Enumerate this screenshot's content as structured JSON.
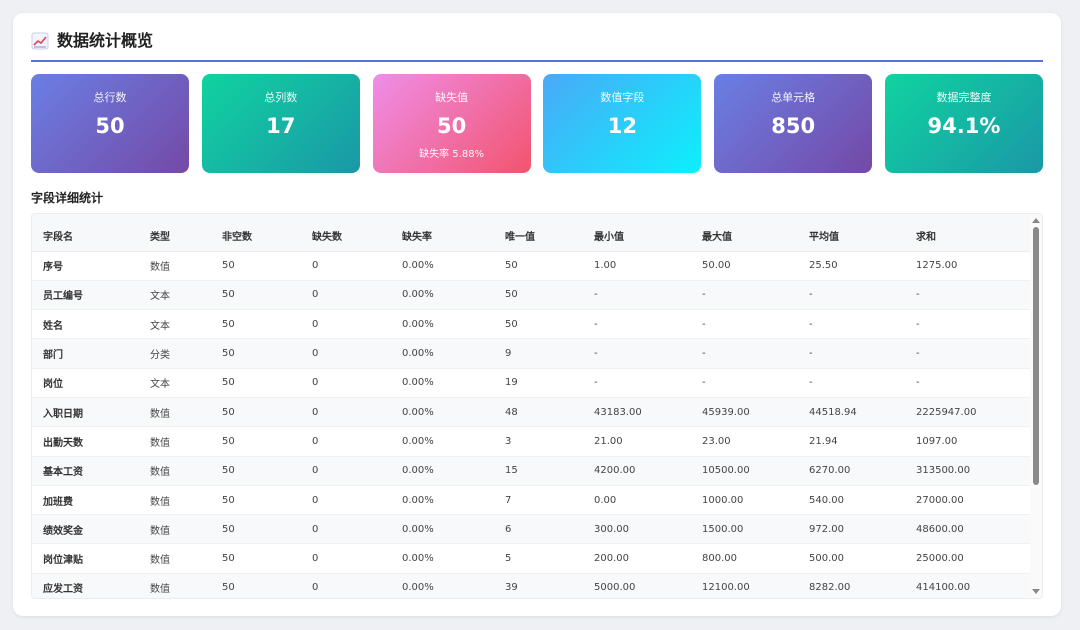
{
  "header": {
    "title": "数据统计概览",
    "icon": "chart-increasing-icon"
  },
  "cards": [
    {
      "label": "总行数",
      "value": "50"
    },
    {
      "label": "总列数",
      "value": "17"
    },
    {
      "label": "缺失值",
      "value": "50",
      "sub": "缺失率 5.88%"
    },
    {
      "label": "数值字段",
      "value": "12"
    },
    {
      "label": "总单元格",
      "value": "850"
    },
    {
      "label": "数据完整度",
      "value": "94.1%"
    }
  ],
  "section_title": "字段详细统计",
  "table": {
    "headers": [
      "字段名",
      "类型",
      "非空数",
      "缺失数",
      "缺失率",
      "唯一值",
      "最小值",
      "最大值",
      "平均值",
      "求和"
    ],
    "rows": [
      [
        "序号",
        "数值",
        "50",
        "0",
        "0.00%",
        "50",
        "1.00",
        "50.00",
        "25.50",
        "1275.00"
      ],
      [
        "员工编号",
        "文本",
        "50",
        "0",
        "0.00%",
        "50",
        "-",
        "-",
        "-",
        "-"
      ],
      [
        "姓名",
        "文本",
        "50",
        "0",
        "0.00%",
        "50",
        "-",
        "-",
        "-",
        "-"
      ],
      [
        "部门",
        "分类",
        "50",
        "0",
        "0.00%",
        "9",
        "-",
        "-",
        "-",
        "-"
      ],
      [
        "岗位",
        "文本",
        "50",
        "0",
        "0.00%",
        "19",
        "-",
        "-",
        "-",
        "-"
      ],
      [
        "入职日期",
        "数值",
        "50",
        "0",
        "0.00%",
        "48",
        "43183.00",
        "45939.00",
        "44518.94",
        "2225947.00"
      ],
      [
        "出勤天数",
        "数值",
        "50",
        "0",
        "0.00%",
        "3",
        "21.00",
        "23.00",
        "21.94",
        "1097.00"
      ],
      [
        "基本工资",
        "数值",
        "50",
        "0",
        "0.00%",
        "15",
        "4200.00",
        "10500.00",
        "6270.00",
        "313500.00"
      ],
      [
        "加班费",
        "数值",
        "50",
        "0",
        "0.00%",
        "7",
        "0.00",
        "1000.00",
        "540.00",
        "27000.00"
      ],
      [
        "绩效奖金",
        "数值",
        "50",
        "0",
        "0.00%",
        "6",
        "300.00",
        "1500.00",
        "972.00",
        "48600.00"
      ],
      [
        "岗位津贴",
        "数值",
        "50",
        "0",
        "0.00%",
        "5",
        "200.00",
        "800.00",
        "500.00",
        "25000.00"
      ],
      [
        "应发工资",
        "数值",
        "50",
        "0",
        "0.00%",
        "39",
        "5000.00",
        "12100.00",
        "8282.00",
        "414100.00"
      ]
    ]
  }
}
